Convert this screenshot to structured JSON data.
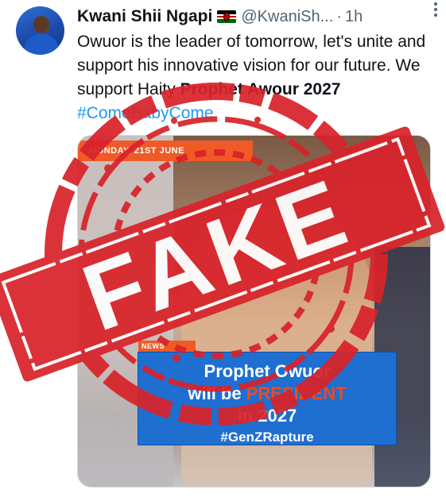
{
  "post": {
    "author_name": "Kwani Shii Ngapi",
    "handle": "@KwaniSh...",
    "separator": "·",
    "time": "1h",
    "more_icon": "more-vertical-icon",
    "flag_icon": "kenya-flag-icon",
    "text_parts": {
      "main": "Owuor is the leader of tomorrow, let's unite and support his innovative vision for our future. We support Haity ",
      "bold": "Prophet Awour 2027",
      "space": " ",
      "hashtag": "#ComeBabyCome"
    }
  },
  "media": {
    "date_strip": "MONDAY, 21ST JUNE",
    "news_tag": "NEWS",
    "banner": {
      "line1": "Prophet Owuor",
      "line2_start": "will be ",
      "line2_accent": "PRESIDENT",
      "line3": "in 2027",
      "hashtag": "#GenZRapture"
    }
  },
  "stamp": {
    "text": "FAKE",
    "color": "#d8232a"
  },
  "colors": {
    "link": "#1d9bf0",
    "muted": "#536471",
    "banner_blue": "#1f6fd1",
    "accent_orange": "#ef5a26"
  }
}
